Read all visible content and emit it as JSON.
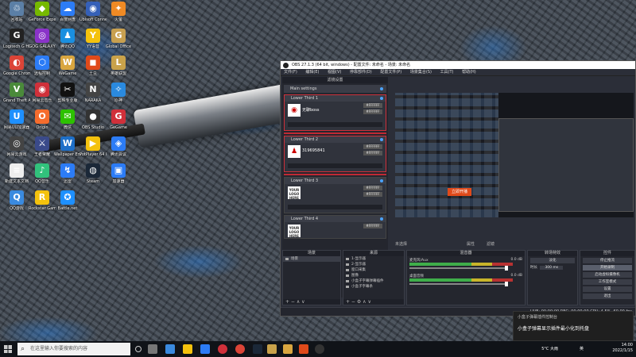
{
  "desktop": {
    "icons": [
      {
        "label": "回收站",
        "color": "#5b7fa6",
        "glyph": "♲"
      },
      {
        "label": "GeForce Experience",
        "color": "#76b900",
        "glyph": "◆"
      },
      {
        "label": "百度网盘",
        "color": "#2c7cf6",
        "glyph": "☁"
      },
      {
        "label": "Ubisoft Connect",
        "color": "#3560b8",
        "glyph": "◉"
      },
      {
        "label": "火萤",
        "color": "#f08a24",
        "glyph": "✦"
      },
      {
        "label": "Logitech G HUB",
        "color": "#222",
        "glyph": "G"
      },
      {
        "label": "GOG GALAXY",
        "color": "#8a33c9",
        "glyph": "◎"
      },
      {
        "label": "腾讯QQ",
        "color": "#1a8fe0",
        "glyph": "♟"
      },
      {
        "label": "YY语音",
        "color": "#f4c20d",
        "glyph": "Y"
      },
      {
        "label": "Global Office",
        "color": "#c8a050",
        "glyph": "G"
      },
      {
        "label": "Google Chrome",
        "color": "#db4437",
        "glyph": "◐"
      },
      {
        "label": "远程控制",
        "color": "#2c7cf6",
        "glyph": "⬡"
      },
      {
        "label": "WeGame",
        "color": "#d9a640",
        "glyph": "W"
      },
      {
        "label": "土豆",
        "color": "#e04a1a",
        "glyph": "◼"
      },
      {
        "label": "英雄联盟",
        "color": "#c9a24a",
        "glyph": "L"
      },
      {
        "label": "Grand Theft Auto V",
        "color": "#4a8a3a",
        "glyph": "V"
      },
      {
        "label": "网易云音乐",
        "color": "#d0303a",
        "glyph": "◉"
      },
      {
        "label": "剪映专业版",
        "color": "#111",
        "glyph": "✂"
      },
      {
        "label": "NARAKA",
        "color": "#444",
        "glyph": "N"
      },
      {
        "label": "原神",
        "color": "#2a8adf",
        "glyph": "✧"
      },
      {
        "label": "网易UU加速器",
        "color": "#1e90ff",
        "glyph": "U"
      },
      {
        "label": "Origin",
        "color": "#f56c2d",
        "glyph": "O"
      },
      {
        "label": "微信",
        "color": "#2dc100",
        "glyph": "✉"
      },
      {
        "label": "OBS Studio",
        "color": "#333",
        "glyph": "●"
      },
      {
        "label": "GeGame",
        "color": "#d0303a",
        "glyph": "G"
      },
      {
        "label": "网易云游戏",
        "color": "#444",
        "glyph": "◎"
      },
      {
        "label": "王者荣耀",
        "color": "#3a4a8a",
        "glyph": "⚔"
      },
      {
        "label": "Wallpaper Engine",
        "color": "#1e6fc8",
        "glyph": "W"
      },
      {
        "label": "PotPlayer 64 bit",
        "color": "#f4c20d",
        "glyph": "▶"
      },
      {
        "label": "腾讯会议",
        "color": "#2c7cf6",
        "glyph": "◈"
      },
      {
        "label": "新建文本文档",
        "color": "#eee",
        "glyph": "≡"
      },
      {
        "label": "QQ音乐",
        "color": "#31c27c",
        "glyph": "♪"
      },
      {
        "label": "迅雷",
        "color": "#2c7cf6",
        "glyph": "↯"
      },
      {
        "label": "Steam",
        "color": "#1b2838",
        "glyph": "◍"
      },
      {
        "label": "加速器",
        "color": "#2c7cf6",
        "glyph": "▣"
      },
      {
        "label": "QQ游戏",
        "color": "#3a8adf",
        "glyph": "Q"
      },
      {
        "label": "Rockstar Games",
        "color": "#f4c20d",
        "glyph": "R"
      },
      {
        "label": "Battle.net",
        "color": "#1e90ff",
        "glyph": "✪"
      }
    ]
  },
  "obs": {
    "title": "OBS 27.1.3 (64 bit, windows) - 配置文件: 未命名 - 场景: 未命名",
    "menu": [
      "文件(F)",
      "编辑(E)",
      "视图(V)",
      "停靠部件(D)",
      "配置文件(P)",
      "场景集合(S)",
      "工具(T)",
      "帮助(H)"
    ],
    "filter_panel_title": "滤镜设置",
    "main_settings": "Main settings",
    "lower_thirds": [
      {
        "name": "Lower Third 1",
        "text": "无聊boss",
        "thumb": "◉",
        "field1": "#FFFFFF",
        "field2": "#FFFFFF"
      },
      {
        "name": "Lower Third 2",
        "text": "319695841",
        "thumb": "♟",
        "field1": "#FFFFFF",
        "field2": "#FFFFFF"
      },
      {
        "name": "Lower Third 3",
        "text": "",
        "thumb": "YOUR LOGO HERE",
        "field1": "#FFFFFF",
        "field2": "#FFFFFF"
      },
      {
        "name": "Lower Third 4",
        "text": "",
        "thumb": "YOUR LOGO HERE",
        "field1": "#FFFFFF",
        "field2": "#FFFFFF"
      }
    ],
    "preview_popup": "立即开播",
    "scene_status": "未选择",
    "preview_controls": [
      "属性",
      "滤镜"
    ],
    "scenes": {
      "title": "场景",
      "items": [
        "场景"
      ],
      "foot": "+ − ∧ ∨"
    },
    "sources": {
      "title": "来源",
      "items": [
        "1-显示器",
        "2-显示器",
        "窗口采集",
        "图像",
        "小盒子字幕弹幕插件",
        "小盒子字幕条"
      ],
      "foot": "+ − ⚙ ∧ ∨"
    },
    "mixer": {
      "title": "混音器",
      "tracks": [
        {
          "name": "麦克风/Aux",
          "db": "0.0 dB"
        },
        {
          "name": "桌面音频",
          "db": "0.0 dB"
        }
      ]
    },
    "transitions": {
      "title": "转场特效",
      "type": "淡化",
      "duration_label": "时长",
      "duration": "300 ms"
    },
    "controls": {
      "title": "控件",
      "buttons": [
        "停止推流",
        "开始录制",
        "启动虚拟摄像机",
        "工作室模式",
        "设置",
        "退出"
      ],
      "active_index": 1
    },
    "status": "LIVE: 00:00:00   REC: 00:00:00   CPU: 4.5%, 60.00 fps"
  },
  "notification": {
    "header": "小盒子弹幕插件控制台",
    "body": "小盒子弹幕显示插件最小化到托盘"
  },
  "taskbar": {
    "search_placeholder": "在这里输入你要搜索的内容",
    "weather": "5°C 大雨",
    "lang": "英",
    "time": "14:00",
    "date": "2022/1/15"
  }
}
